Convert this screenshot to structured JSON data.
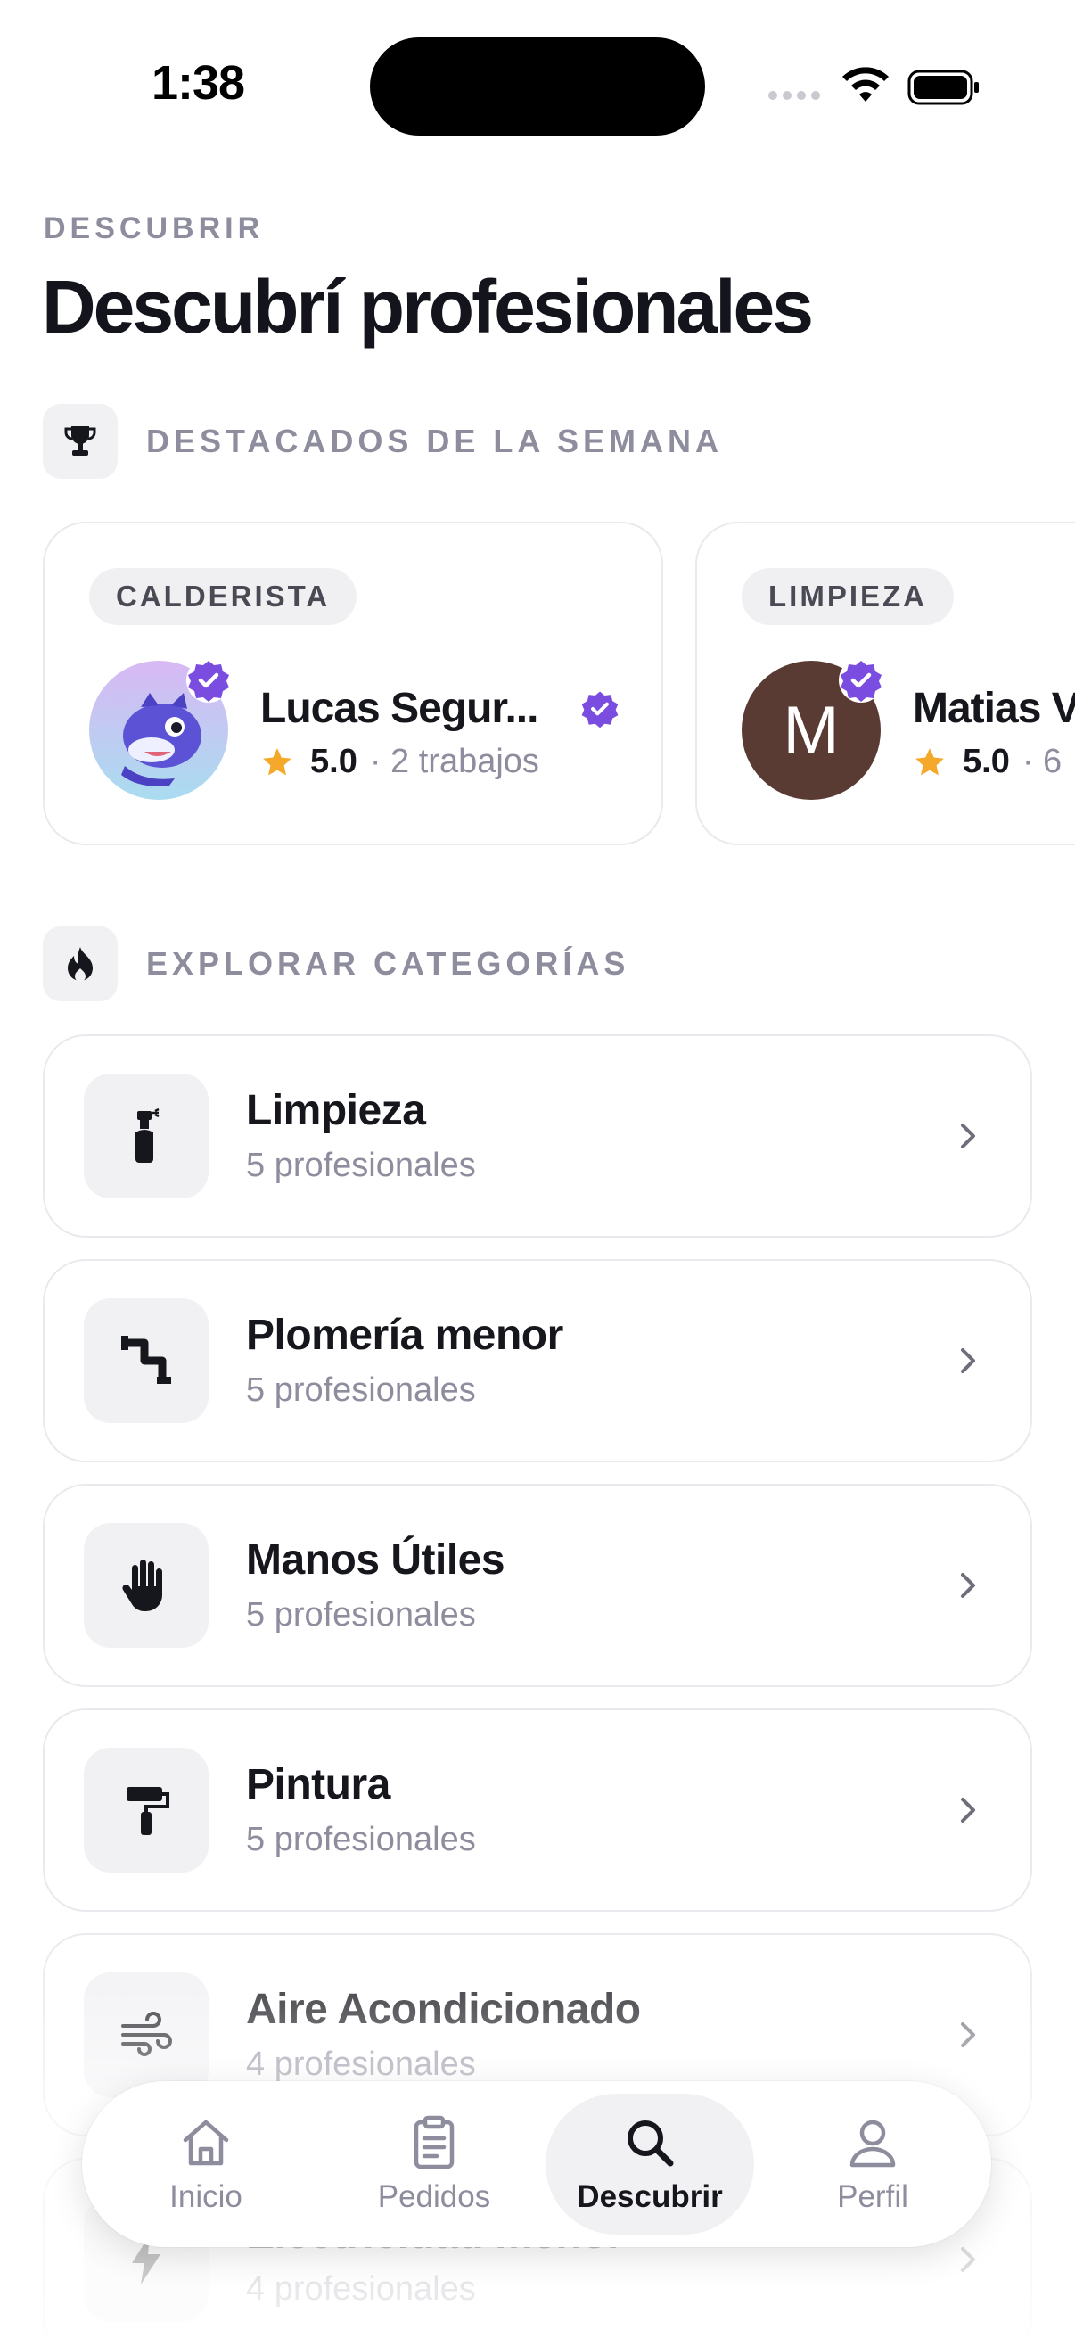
{
  "status_bar": {
    "time": "1:38"
  },
  "header": {
    "eyebrow": "DESCUBRIR",
    "title": "Descubrí profesionales"
  },
  "featured": {
    "label": "DESTACADOS DE LA SEMANA",
    "icon": "trophy-icon",
    "cards": [
      {
        "category": "CALDERISTA",
        "name": "Lucas Segur...",
        "rating": "5.0",
        "jobs": "· 2 trabajos",
        "avatar": "mascot-image",
        "verified": true
      },
      {
        "category": "LIMPIEZA",
        "name": "Matias V",
        "rating": "5.0",
        "jobs": "· 6",
        "avatar_letter": "M",
        "verified": true
      }
    ]
  },
  "categories": {
    "label": "EXPLORAR CATEGORÍAS",
    "icon": "flame-icon",
    "items": [
      {
        "title": "Limpieza",
        "subtitle": "5 profesionales",
        "icon": "spray-bottle-icon"
      },
      {
        "title": "Plomería menor",
        "subtitle": "5 profesionales",
        "icon": "pipe-icon"
      },
      {
        "title": "Manos Útiles",
        "subtitle": "5 profesionales",
        "icon": "hand-icon"
      },
      {
        "title": "Pintura",
        "subtitle": "5 profesionales",
        "icon": "paint-roller-icon"
      },
      {
        "title": "Aire Acondicionado",
        "subtitle": "4 profesionales",
        "icon": "wind-icon"
      },
      {
        "title": "Electricidad menor",
        "subtitle": "4 profesionales",
        "icon": "lightning-icon"
      }
    ]
  },
  "tabs": [
    {
      "label": "Inicio",
      "icon": "home-icon",
      "active": false
    },
    {
      "label": "Pedidos",
      "icon": "clipboard-icon",
      "active": false
    },
    {
      "label": "Descubrir",
      "icon": "search-icon",
      "active": true
    },
    {
      "label": "Perfil",
      "icon": "user-icon",
      "active": false
    }
  ],
  "colors": {
    "accent": "#7b4ce0",
    "star": "#f4a92a",
    "muted": "#8e8d9e",
    "text": "#16161d"
  }
}
